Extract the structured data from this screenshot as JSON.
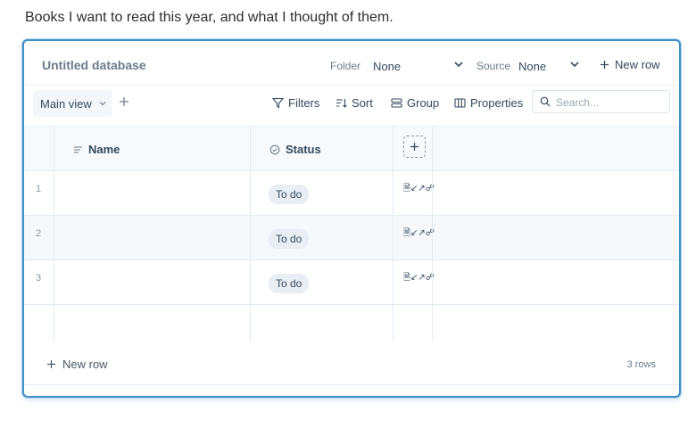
{
  "intro": "Books I want to read this year, and what I thought of them.",
  "header": {
    "title": "Untitled database",
    "folder_label": "Folder",
    "folder_value": "None",
    "source_label": "Source",
    "source_value": "None",
    "new_row": "New row"
  },
  "toolbar": {
    "view": "Main view",
    "filters": "Filters",
    "sort": "Sort",
    "group": "Group",
    "properties": "Properties",
    "search_placeholder": "Search..."
  },
  "columns": {
    "name": "Name",
    "status": "Status"
  },
  "rows": [
    {
      "num": "1",
      "status": "To do"
    },
    {
      "num": "2",
      "status": "To do"
    },
    {
      "num": "3",
      "status": "To do"
    }
  ],
  "footer": {
    "new_row": "New row",
    "count": "3 rows"
  },
  "colors": {
    "accent_border": "#3f8fc9",
    "chip_bg": "#e8eef4",
    "alt_row": "#f5f9fc"
  }
}
